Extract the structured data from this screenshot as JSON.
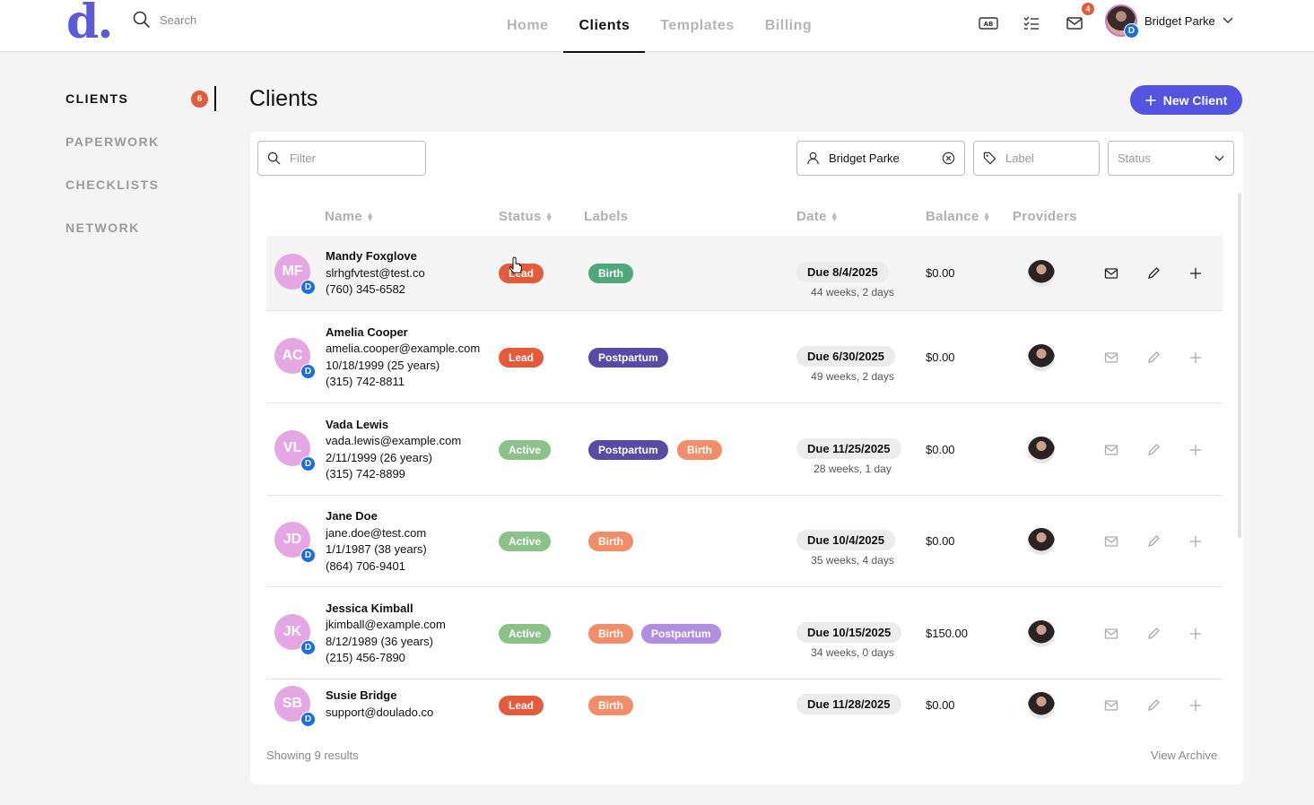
{
  "topbar": {
    "logo": "d",
    "search_placeholder": "Search",
    "tabs": [
      {
        "label": "Home",
        "active": false
      },
      {
        "label": "Clients",
        "active": true
      },
      {
        "label": "Templates",
        "active": false
      },
      {
        "label": "Billing",
        "active": false
      }
    ],
    "mail_count": "4",
    "user_name": "Bridget Parke",
    "avatar_badge": "D"
  },
  "sidebar": {
    "items": [
      {
        "label": "CLIENTS",
        "active": true
      },
      {
        "label": "PAPERWORK",
        "active": false
      },
      {
        "label": "CHECKLISTS",
        "active": false
      },
      {
        "label": "NETWORK",
        "active": false
      }
    ],
    "clients_count": "6"
  },
  "page": {
    "title": "Clients",
    "new_button": "New Client"
  },
  "filters": {
    "filter_placeholder": "Filter",
    "provider_value": "Bridget Parke",
    "label_placeholder": "Label",
    "status_placeholder": "Status"
  },
  "table": {
    "columns": [
      "Name",
      "Status",
      "Labels",
      "Date",
      "Balance",
      "Providers"
    ],
    "rows": [
      {
        "initials": "MF",
        "badge": "D",
        "name": "Mandy  Foxglove",
        "lines": [
          "slrhgfvtest@test.co",
          "(760) 345-6582"
        ],
        "status": "Lead",
        "labels": [
          "Birth"
        ],
        "due": "Due 8/4/2025",
        "weeks": "44 weeks, 2 days",
        "balance": "$0.00"
      },
      {
        "initials": "AC",
        "badge": "D",
        "name": "Amelia Cooper",
        "lines": [
          "amelia.cooper@example.com",
          "10/18/1999 (25 years)",
          "(315) 742-8811"
        ],
        "status": "Lead",
        "labels": [
          "Postpartum"
        ],
        "due": "Due 6/30/2025",
        "weeks": "49 weeks, 2 days",
        "balance": "$0.00"
      },
      {
        "initials": "VL",
        "badge": "D",
        "name": "Vada Lewis",
        "lines": [
          "vada.lewis@example.com",
          "2/11/1999 (26 years)",
          "(315) 742-8899"
        ],
        "status": "Active",
        "labels": [
          "Postpartum",
          "Birth"
        ],
        "due": "Due 11/25/2025",
        "weeks": "28 weeks, 1 day",
        "balance": "$0.00"
      },
      {
        "initials": "JD",
        "badge": "D",
        "name": "Jane Doe",
        "lines": [
          "jane.doe@test.com",
          "1/1/1987 (38 years)",
          "(864) 706-9401"
        ],
        "status": "Active",
        "labels": [
          "Birth"
        ],
        "due": "Due 10/4/2025",
        "weeks": "35 weeks, 4 days",
        "balance": "$0.00"
      },
      {
        "initials": "JK",
        "badge": "D",
        "name": "Jessica Kimball",
        "lines": [
          "jkimball@example.com",
          "8/12/1989 (36 years)",
          "(215) 456-7890"
        ],
        "status": "Active",
        "labels": [
          "Birth",
          "Postpartum"
        ],
        "due": "Due 10/15/2025",
        "weeks": "34 weeks, 0 days",
        "balance": "$150.00"
      },
      {
        "initials": "SB",
        "badge": "D",
        "name": "Susie Bridge",
        "lines": [
          "support@doulado.co"
        ],
        "status": "Lead",
        "labels": [
          "Birth"
        ],
        "due": "Due 11/28/2025",
        "weeks": "",
        "balance": "$0.00"
      }
    ]
  },
  "footer": {
    "showing": "Showing 9 results",
    "archive": "View Archive"
  },
  "colors": {
    "accent": "#5454e0",
    "lead": "#e35b3b",
    "active": "#8cc28a",
    "birth_primary": "#4fa878",
    "birth": "#f28d6a",
    "postpartum": "#5a4aa8",
    "postpartum_light": "#b18ee0"
  }
}
